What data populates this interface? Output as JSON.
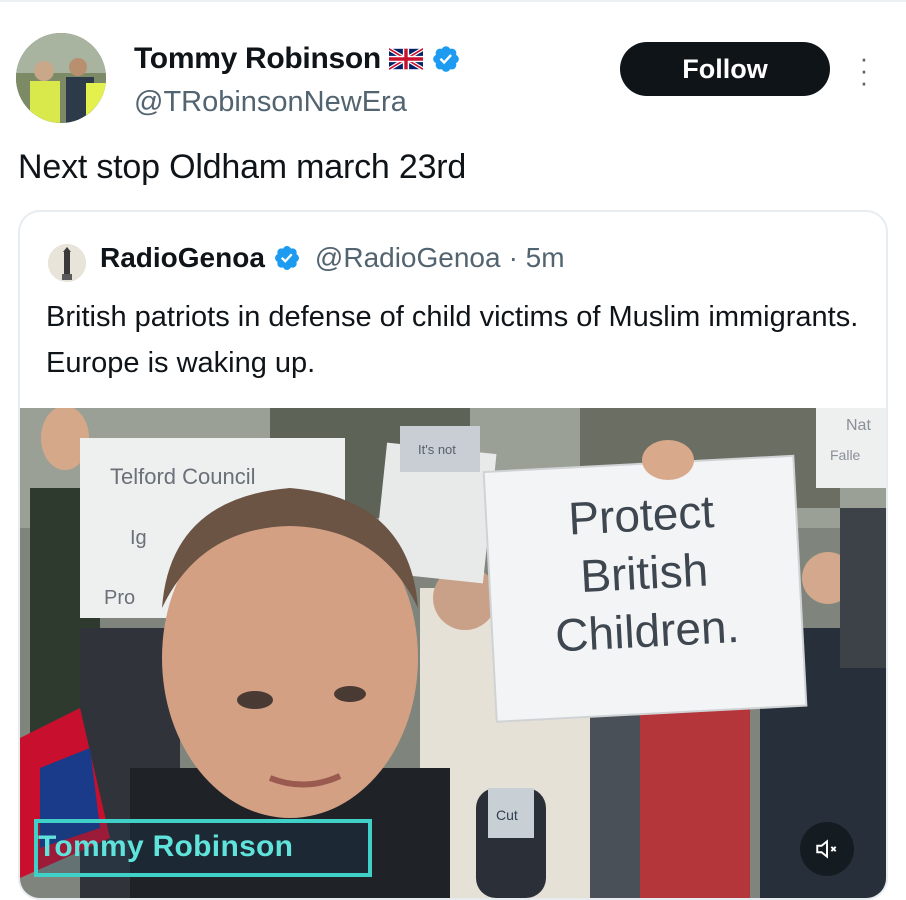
{
  "author": {
    "name": "Tommy Robinson",
    "handle": "@TRobinsonNewEra",
    "follow_label": "Follow",
    "flag_icon": "uk-flag-icon",
    "verified_icon": "verified-badge-icon",
    "verified_color": "#1d9bf0"
  },
  "tweet": {
    "text": "Next stop Oldham march 23rd"
  },
  "quoted": {
    "name": "RadioGenoa",
    "handle": "@RadioGenoa",
    "time": "· 5m",
    "text": "British patriots in defense of child victims of Muslim immigrants. Europe is waking up."
  },
  "media": {
    "caption": "Tommy Robinson",
    "caption_color": "#5fe3db",
    "mute_icon": "volume-mute-icon",
    "signs": {
      "main_line1": "Protect",
      "main_line2": "British",
      "main_line3": "Children.",
      "left_line1": "Telford Council",
      "left_line2": "Ig",
      "left_line3": "Pro",
      "right_line1": "Nat",
      "right_line2": "Falle",
      "small_sign": "It's not",
      "mic_label": "Cut"
    }
  }
}
